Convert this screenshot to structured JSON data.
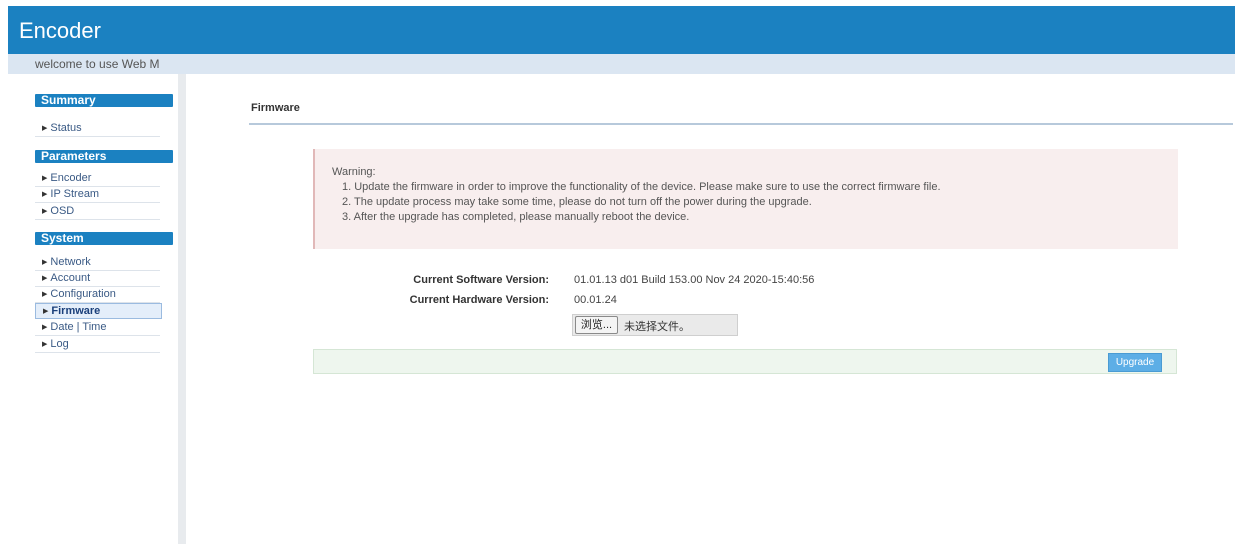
{
  "app": {
    "title": "Encoder",
    "welcome": "welcome to use Web M"
  },
  "sidebar": {
    "sections": [
      {
        "title": "Summary",
        "items": [
          {
            "label": "Status"
          }
        ]
      },
      {
        "title": "Parameters",
        "items": [
          {
            "label": "Encoder"
          },
          {
            "label": "IP Stream"
          },
          {
            "label": "OSD"
          }
        ]
      },
      {
        "title": "System",
        "items": [
          {
            "label": "Network"
          },
          {
            "label": "Account"
          },
          {
            "label": "Configuration"
          },
          {
            "label": "Firmware",
            "active": true
          },
          {
            "label": "Date | Time"
          },
          {
            "label": "Log"
          }
        ]
      }
    ]
  },
  "main": {
    "title": "Firmware",
    "warning": {
      "title": "Warning:",
      "lines": [
        "1. Update the firmware in order to improve the functionality of the device. Please make sure to use the correct firmware file.",
        "2. The update process may take some time, please do not turn off the power during the upgrade.",
        "3. After the upgrade has completed, please manually reboot the device."
      ]
    },
    "software_version": {
      "label": "Current Software Version:",
      "value": "01.01.13 d01 Build 153.00 Nov 24 2020-15:40:56"
    },
    "hardware_version": {
      "label": "Current Hardware Version:",
      "value": "00.01.24"
    },
    "file_input": {
      "browse_label": "浏览...",
      "status": "未选择文件。"
    },
    "upgrade_label": "Upgrade"
  },
  "colors": {
    "header": "#1b81c1",
    "welcome_bar": "#dbe6f2",
    "warning_bg": "#f8eeee",
    "action_bar": "#eef6ee",
    "upgrade_button": "#5daee6"
  },
  "icons": {
    "nav_bullet": "triangle-right-icon"
  }
}
